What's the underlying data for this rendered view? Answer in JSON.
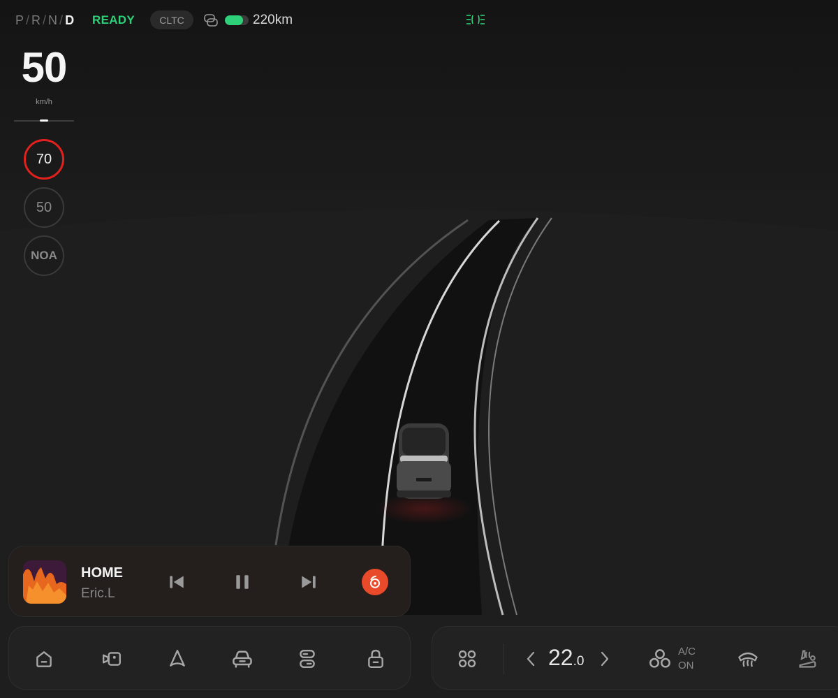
{
  "status": {
    "gears": [
      "P",
      "R",
      "N",
      "D"
    ],
    "gear_separator": "/",
    "ready": "READY",
    "range_mode": "CLTC",
    "battery_level": 0.75,
    "range": "220km",
    "icons": [
      "connect-icon",
      "headlight-icon"
    ],
    "accent_color": "#2fd07a"
  },
  "drive": {
    "speed": "50",
    "speed_unit": "km/h",
    "speed_limit": "70",
    "cruise_speed": "50",
    "assist_mode": "NOA"
  },
  "media": {
    "title": "HOME",
    "artist": "Eric.L",
    "icons": [
      "previous-icon",
      "pause-icon",
      "next-icon",
      "music-app-icon"
    ]
  },
  "dock": {
    "icons": [
      "home-icon",
      "camera-icon",
      "navigation-icon",
      "car-icon",
      "toggle-icon",
      "lock-icon"
    ]
  },
  "climate": {
    "temp_int": "22",
    "temp_dec": ".0",
    "ac_label": "A/C",
    "ac_state": "ON",
    "icons": [
      "apps-icon",
      "temp-down-icon",
      "temp-up-icon",
      "fan-icon",
      "defrost-icon",
      "seat-heat-icon"
    ]
  }
}
